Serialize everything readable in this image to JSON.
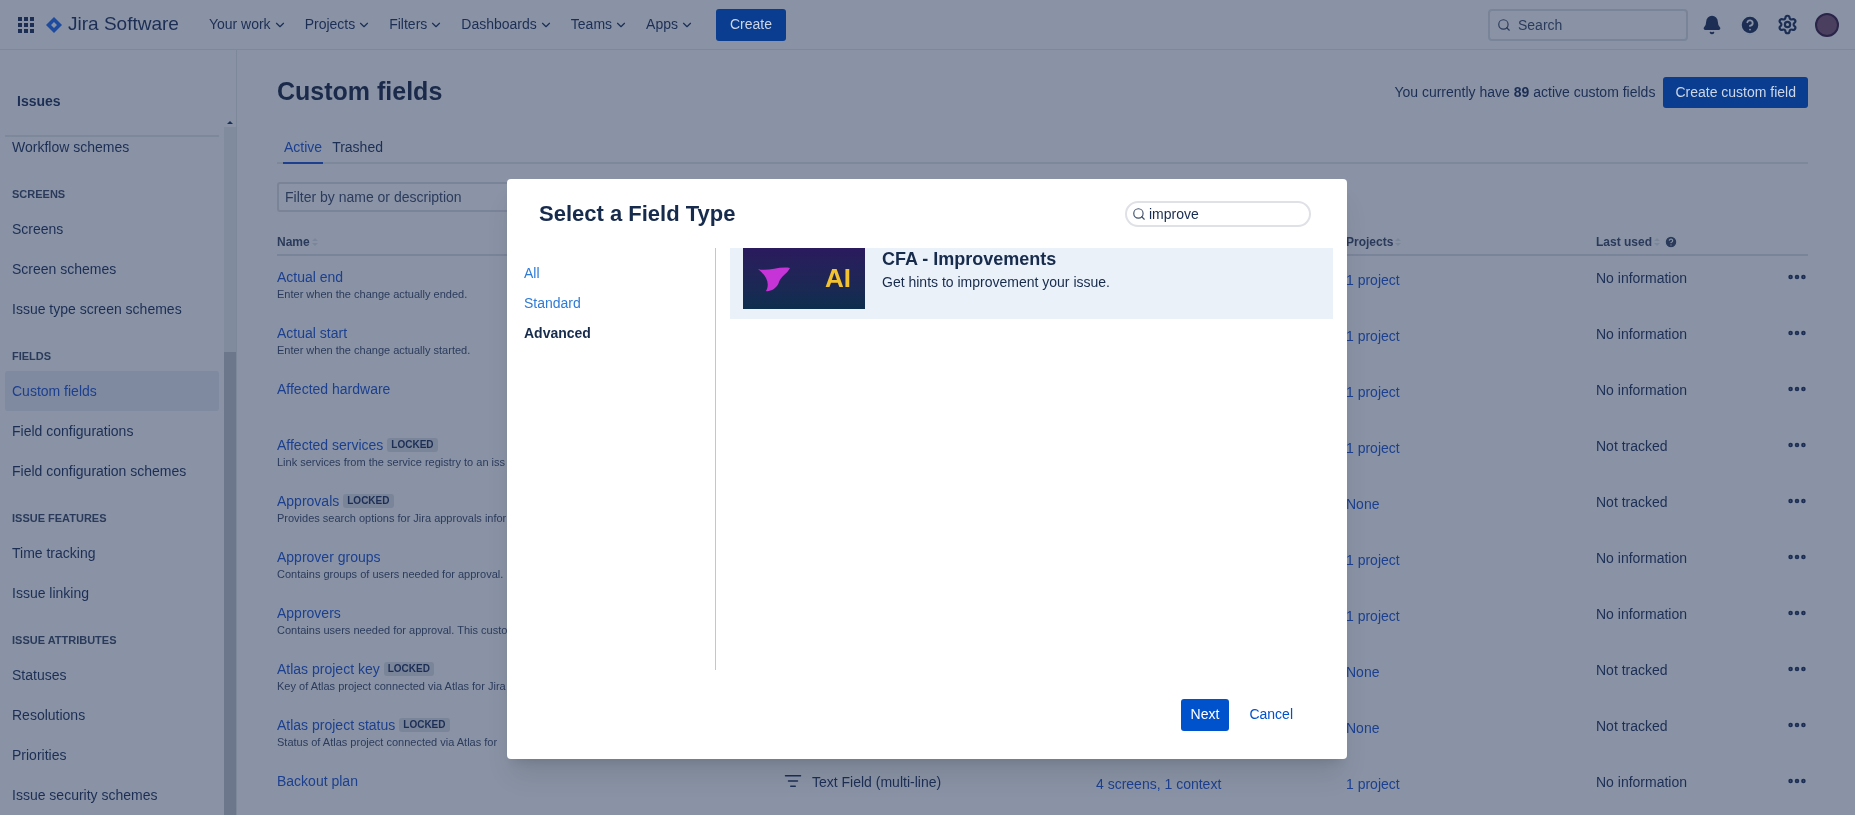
{
  "topnav": {
    "product": "Jira Software",
    "menus": [
      {
        "label": "Your work"
      },
      {
        "label": "Projects"
      },
      {
        "label": "Filters"
      },
      {
        "label": "Dashboards"
      },
      {
        "label": "Teams"
      },
      {
        "label": "Apps"
      }
    ],
    "create": "Create",
    "search": {
      "placeholder": "Search"
    }
  },
  "sidebar": {
    "title": "Issues",
    "sections": [
      {
        "items": [
          {
            "label": "Workflow schemes",
            "selected": false
          }
        ]
      },
      {
        "heading": "SCREENS",
        "items": [
          {
            "label": "Screens",
            "selected": false
          },
          {
            "label": "Screen schemes",
            "selected": false
          },
          {
            "label": "Issue type screen schemes",
            "selected": false
          }
        ]
      },
      {
        "heading": "FIELDS",
        "items": [
          {
            "label": "Custom fields",
            "selected": true
          },
          {
            "label": "Field configurations",
            "selected": false
          },
          {
            "label": "Field configuration schemes",
            "selected": false
          }
        ]
      },
      {
        "heading": "ISSUE FEATURES",
        "items": [
          {
            "label": "Time tracking",
            "selected": false
          },
          {
            "label": "Issue linking",
            "selected": false
          }
        ]
      },
      {
        "heading": "ISSUE ATTRIBUTES",
        "items": [
          {
            "label": "Statuses",
            "selected": false
          },
          {
            "label": "Resolutions",
            "selected": false
          },
          {
            "label": "Priorities",
            "selected": false
          },
          {
            "label": "Issue security schemes",
            "selected": false
          }
        ]
      }
    ]
  },
  "page": {
    "title": "Custom fields",
    "summary": "You currently have **89** active custom fields",
    "create_button": "Create custom field",
    "tabs": [
      {
        "label": "Active",
        "selected": true
      },
      {
        "label": "Trashed",
        "selected": false
      }
    ],
    "filter": {
      "placeholder": "Filter by name or description"
    }
  },
  "table": {
    "columns": {
      "name": "Name",
      "projects": "Projects",
      "last_used": "Last used"
    },
    "rows": [
      {
        "name": "Actual end",
        "description": "Enter when the change actually ended.",
        "projects": "1 project",
        "last_used": "No information"
      },
      {
        "name": "Actual start",
        "description": "Enter when the change actually started.",
        "projects": "1 project",
        "last_used": "No information"
      },
      {
        "name": "Affected hardware",
        "projects": "1 project",
        "last_used": "No information"
      },
      {
        "name": "Affected services",
        "badge": "LOCKED",
        "description": "Link services from the service registry to an iss",
        "projects": "1 project",
        "last_used": "Not tracked"
      },
      {
        "name": "Approvals",
        "badge": "LOCKED",
        "description": "Provides search options for Jira approvals infor",
        "projects": "None",
        "last_used": "Not tracked"
      },
      {
        "name": "Approver groups",
        "description": "Contains groups of users needed for approval.",
        "projects": "1 project",
        "last_used": "No information"
      },
      {
        "name": "Approvers",
        "description": "Contains users needed for approval. This custo",
        "projects": "1 project",
        "last_used": "No information"
      },
      {
        "name": "Atlas project key",
        "badge": "LOCKED",
        "description": "Key of Atlas project connected via Atlas for Jira",
        "projects": "None",
        "last_used": "Not tracked"
      },
      {
        "name": "Atlas project status",
        "badge": "LOCKED",
        "description": "Status of Atlas project connected via Atlas for",
        "projects": "None",
        "last_used": "Not tracked"
      },
      {
        "name": "Backout plan",
        "type": "Text Field (multi-line)",
        "screens": "4 screens, 1 context",
        "projects": "1 project",
        "last_used": "No information"
      }
    ]
  },
  "dialog": {
    "title": "Select a Field Type",
    "search": {
      "value": "improve"
    },
    "categories": [
      {
        "label": "All",
        "selected": false
      },
      {
        "label": "Standard",
        "selected": false
      },
      {
        "label": "Advanced",
        "selected": true
      }
    ],
    "results": [
      {
        "title": "CFA - Improvements",
        "description": "Get hints to improvement your issue.",
        "image_text": "AI",
        "selected": true
      }
    ],
    "next": "Next",
    "cancel": "Cancel"
  }
}
